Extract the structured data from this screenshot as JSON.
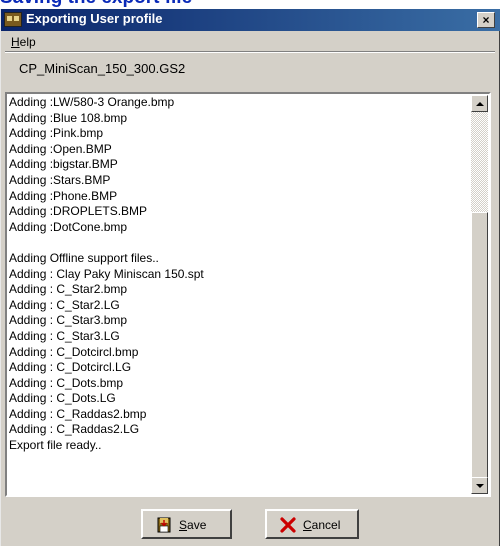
{
  "page": {
    "heading": "Saving the export file"
  },
  "window": {
    "title": "Exporting User profile",
    "close_glyph": "×",
    "app_icon": "app-icon"
  },
  "menu": {
    "help_mnemonic": "H",
    "help_rest": "elp"
  },
  "profile": {
    "name": "CP_MiniScan_150_300.GS2"
  },
  "log": {
    "lines": [
      "Adding :LW/580-3 Orange.bmp",
      "Adding :Blue 108.bmp",
      "Adding :Pink.bmp",
      "Adding :Open.BMP",
      "Adding :bigstar.BMP",
      "Adding :Stars.BMP",
      "Adding :Phone.BMP",
      "Adding :DROPLETS.BMP",
      "Adding :DotCone.bmp",
      "",
      "Adding Offline support files..",
      "Adding : Clay Paky Miniscan 150.spt",
      "Adding : C_Star2.bmp",
      "Adding : C_Star2.LG",
      "Adding : C_Star3.bmp",
      "Adding : C_Star3.LG",
      "Adding : C_Dotcircl.bmp",
      "Adding : C_Dotcircl.LG",
      "Adding : C_Dots.bmp",
      "Adding : C_Dots.LG",
      "Adding : C_Raddas2.bmp",
      "Adding : C_Raddas2.LG",
      "Export file ready.."
    ]
  },
  "buttons": {
    "save_mnemonic": "S",
    "save_rest": "ave",
    "save_icon": "save-icon",
    "cancel_mnemonic": "C",
    "cancel_rest": "ancel",
    "cancel_icon": "cancel-x-icon"
  },
  "colors": {
    "title_bar": "#0a246a",
    "dialog_face": "#d4d0c8",
    "heading": "#0a2ab8",
    "cancel_x": "#cc0000"
  }
}
